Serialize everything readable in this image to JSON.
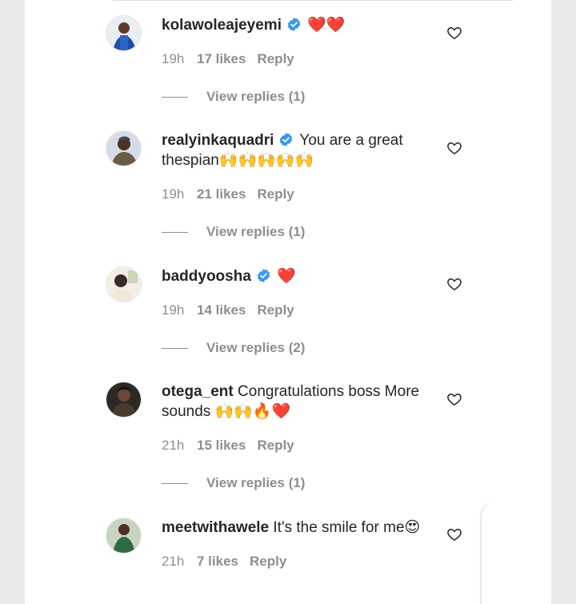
{
  "comments": [
    {
      "username": "kolawoleajeyemi",
      "verified": true,
      "text": "",
      "emoji": "❤️❤️",
      "time": "19h",
      "likes": "17 likes",
      "reply": "Reply",
      "replies": "View replies (1)"
    },
    {
      "username": "realyinkaquadri",
      "verified": true,
      "text": "You are a great thespian",
      "emoji": "🙌🙌🙌🙌🙌",
      "time": "19h",
      "likes": "21 likes",
      "reply": "Reply",
      "replies": "View replies (1)"
    },
    {
      "username": "baddyoosha",
      "verified": true,
      "text": "",
      "emoji": "❤️",
      "time": "19h",
      "likes": "14 likes",
      "reply": "Reply",
      "replies": "View replies (2)"
    },
    {
      "username": "otega_ent",
      "verified": false,
      "text": "Congratulations boss More sounds",
      "emoji": "🙌🙌🔥❤️",
      "time": "21h",
      "likes": "15 likes",
      "reply": "Reply",
      "replies": "View replies (1)"
    },
    {
      "username": "meetwithawele",
      "verified": false,
      "text": "It's the smile for me",
      "emoji": "😍",
      "time": "21h",
      "likes": "7 likes",
      "reply": "Reply",
      "replies": ""
    }
  ],
  "icons": {
    "verified": "verified-badge-icon",
    "like": "heart-outline-icon"
  },
  "colors": {
    "verified_blue": "#3897f0",
    "meta_gray": "#8e8e8e",
    "text": "#262626"
  }
}
